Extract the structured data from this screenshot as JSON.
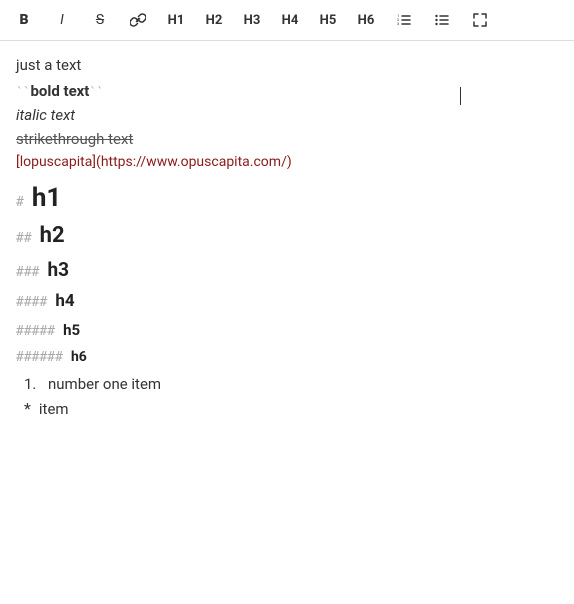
{
  "toolbar": {
    "buttons": [
      {
        "label": "B",
        "name": "bold-button",
        "style": "bold"
      },
      {
        "label": "I",
        "name": "italic-button",
        "style": "italic"
      },
      {
        "label": "S",
        "name": "strikethrough-button",
        "style": "strike"
      },
      {
        "label": "🔗",
        "name": "link-button",
        "style": "link"
      },
      {
        "label": "H1",
        "name": "h1-button"
      },
      {
        "label": "H2",
        "name": "h2-button"
      },
      {
        "label": "H3",
        "name": "h3-button"
      },
      {
        "label": "H4",
        "name": "h4-button"
      },
      {
        "label": "H5",
        "name": "h5-button"
      },
      {
        "label": "H6",
        "name": "h6-button"
      },
      {
        "label": "ol",
        "name": "ordered-list-button",
        "style": "ol"
      },
      {
        "label": "ul",
        "name": "unordered-list-button",
        "style": "ul"
      },
      {
        "label": "↗",
        "name": "expand-button"
      }
    ]
  },
  "editor": {
    "lines": [
      {
        "text": "just a text",
        "type": "plain"
      },
      {
        "text": "bold text",
        "type": "bold"
      },
      {
        "text": "italic text",
        "type": "italic"
      },
      {
        "text": "strikethrough text",
        "type": "strikethrough"
      },
      {
        "text": "[lopuscapita](https://www.opuscapita.com/)",
        "type": "link"
      }
    ],
    "headings": [
      {
        "hashes": "#",
        "level": "h1",
        "text": "h1"
      },
      {
        "hashes": "##",
        "level": "h2",
        "text": "h2"
      },
      {
        "hashes": "###",
        "level": "h3",
        "text": "h3"
      },
      {
        "hashes": "####",
        "level": "h4",
        "text": "h4"
      },
      {
        "hashes": "#####",
        "level": "h5",
        "text": "h5"
      },
      {
        "hashes": "######",
        "level": "h6",
        "text": "h6"
      }
    ],
    "list_items": [
      {
        "type": "numbered",
        "num": "1.",
        "text": "number one item"
      },
      {
        "type": "bullet",
        "bullet": "*",
        "text": "item"
      }
    ]
  }
}
